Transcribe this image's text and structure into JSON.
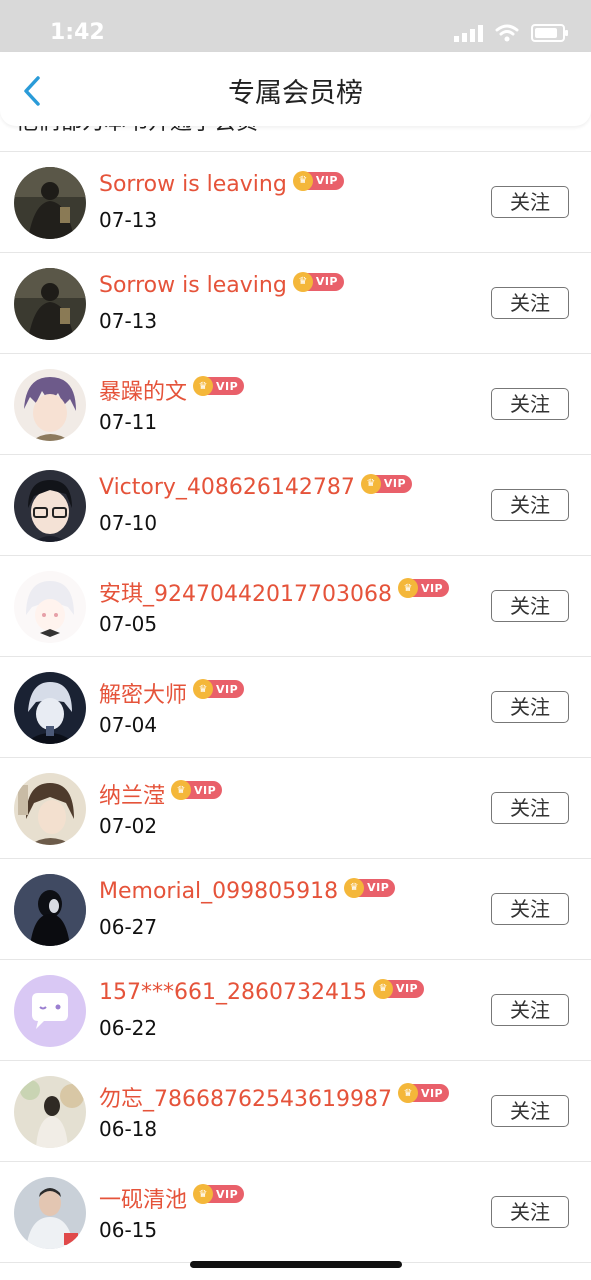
{
  "status": {
    "time": "1:42"
  },
  "header": {
    "title": "专属会员榜"
  },
  "subtitle_partial": "他们都为本书开通了会员",
  "badge_text": "VIP",
  "members": [
    {
      "name": "Sorrow is leaving",
      "date": "07-13",
      "follow_label": "关注",
      "avatar": "dark-photo"
    },
    {
      "name": "Sorrow is leaving",
      "date": "07-13",
      "follow_label": "关注",
      "avatar": "dark-photo"
    },
    {
      "name": "暴躁的文",
      "date": "07-11",
      "follow_label": "关注",
      "avatar": "anime-purple-hair"
    },
    {
      "name": "Victory_408626142787",
      "date": "07-10",
      "follow_label": "关注",
      "avatar": "anime-glasses"
    },
    {
      "name": "安琪_92470442017703068",
      "date": "07-05",
      "follow_label": "关注",
      "avatar": "anime-white-hair"
    },
    {
      "name": "解密大师",
      "date": "07-04",
      "follow_label": "关注",
      "avatar": "anime-dark"
    },
    {
      "name": "纳兰滢",
      "date": "07-02",
      "follow_label": "关注",
      "avatar": "anime-brown-hair"
    },
    {
      "name": "Memorial_099805918",
      "date": "06-27",
      "follow_label": "关注",
      "avatar": "dark-figure"
    },
    {
      "name": "157***661_2860732415",
      "date": "06-22",
      "follow_label": "关注",
      "avatar": "default-chat-bubble"
    },
    {
      "name": "勿忘_78668762543619987",
      "date": "06-18",
      "follow_label": "关注",
      "avatar": "photo-person"
    },
    {
      "name": "一砚清池",
      "date": "06-15",
      "follow_label": "关注",
      "avatar": "photo-man"
    }
  ],
  "colors": {
    "name": "#e5533a",
    "vip_badge": "#e9606a",
    "crown": "#f4b73a",
    "back_arrow": "#2a9bd8"
  }
}
